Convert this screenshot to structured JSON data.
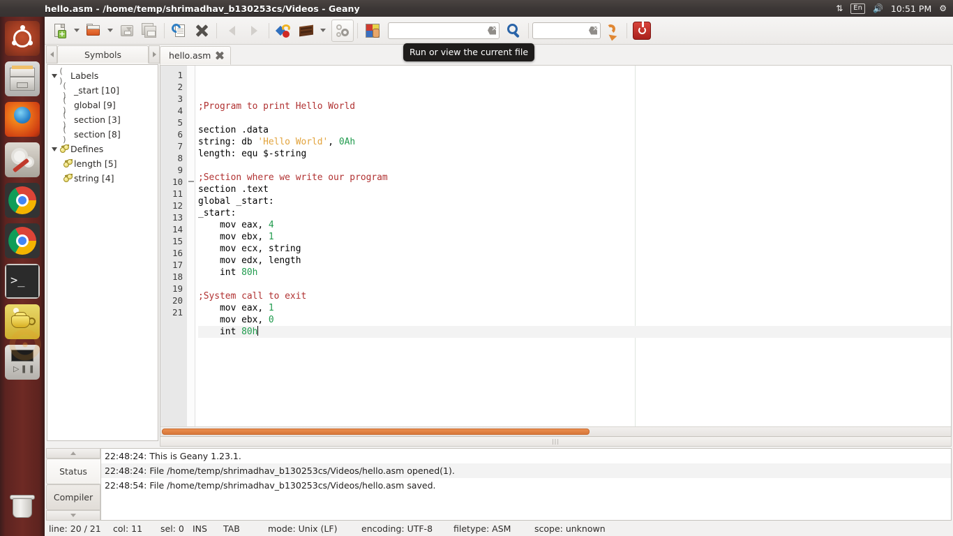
{
  "top_panel": {
    "window_title": "hello.asm - /home/temp/shrimadhav_b130253cs/Videos - Geany",
    "tray": {
      "network_icon": "network-updown-icon",
      "keyboard_layout": "En",
      "volume_icon": "volume-icon",
      "clock": "10:51 PM",
      "settings_icon": "gear-icon"
    }
  },
  "launcher": {
    "items": [
      {
        "name": "ubuntu-dash",
        "label": "Ubuntu Dash",
        "running": false
      },
      {
        "name": "files",
        "label": "Files",
        "running": true
      },
      {
        "name": "firefox",
        "label": "Firefox",
        "running": true
      },
      {
        "name": "system-settings",
        "label": "System Settings",
        "running": false
      },
      {
        "name": "chrome",
        "label": "Google Chrome",
        "running": false
      },
      {
        "name": "chrome-2",
        "label": "Google Chrome",
        "running": true
      },
      {
        "name": "terminal",
        "label": "Terminal",
        "running": true
      },
      {
        "name": "java-app",
        "label": "Java Application",
        "running": true,
        "focused": true
      },
      {
        "name": "media-player",
        "label": "Media Player",
        "running": false
      },
      {
        "name": "trash",
        "label": "Trash",
        "running": false
      }
    ]
  },
  "toolbar": {
    "new_label": "New",
    "open_label": "Open",
    "save_label": "Save",
    "save_all_label": "Save All",
    "revert_label": "Revert",
    "close_label": "Close",
    "back_label": "Navigate back a location",
    "forward_label": "Navigate forward a location",
    "compile_label": "Compile the current file",
    "build_label": "Build the current file",
    "build_menu_label": "Build menu",
    "run_label": "Run or view the current file",
    "color_chooser_label": "Open Color Chooser",
    "search_value": "",
    "search_placeholder": "",
    "goto_value": "",
    "goto_placeholder": "",
    "find_label": "Find the entered text in the current file",
    "jump_label": "Jump to the entered line number",
    "quit_label": "Quit Geany"
  },
  "tooltip": {
    "text": "Run or view the current file"
  },
  "sidebar": {
    "tab_label": "Symbols",
    "prev_arrow": "chevron-left-icon",
    "next_arrow": "chevron-right-icon",
    "tree": [
      {
        "label": "Labels",
        "type": "group",
        "icon": "braces-icon",
        "expanded": true
      },
      {
        "label": "_start [10]",
        "type": "symbol",
        "icon": "braces-icon"
      },
      {
        "label": "global [9]",
        "type": "symbol",
        "icon": "braces-icon"
      },
      {
        "label": "section [3]",
        "type": "symbol",
        "icon": "braces-icon"
      },
      {
        "label": "section [8]",
        "type": "symbol",
        "icon": "braces-icon"
      },
      {
        "label": "Defines",
        "type": "group",
        "icon": "define-icon",
        "expanded": true
      },
      {
        "label": "length [5]",
        "type": "symbol",
        "icon": "define-icon"
      },
      {
        "label": "string [4]",
        "type": "symbol",
        "icon": "define-icon"
      }
    ]
  },
  "editor": {
    "tab_label": "hello.asm",
    "close_icon": "close-icon",
    "line_numbers": [
      "1",
      "2",
      "3",
      "4",
      "5",
      "6",
      "7",
      "8",
      "9",
      "10",
      "11",
      "12",
      "13",
      "14",
      "15",
      "16",
      "17",
      "18",
      "19",
      "20",
      "21"
    ],
    "current_line": 20,
    "lines": [
      {
        "n": 1,
        "tokens": [
          {
            "t": ";Program to print Hello World",
            "c": "comment"
          }
        ]
      },
      {
        "n": 2,
        "tokens": []
      },
      {
        "n": 3,
        "tokens": [
          {
            "t": "section .data",
            "c": "plain"
          }
        ]
      },
      {
        "n": 4,
        "tokens": [
          {
            "t": "string: db ",
            "c": "plain"
          },
          {
            "t": "'Hello World'",
            "c": "string"
          },
          {
            "t": ", ",
            "c": "plain"
          },
          {
            "t": "0Ah",
            "c": "number"
          }
        ]
      },
      {
        "n": 5,
        "tokens": [
          {
            "t": "length: equ $-string",
            "c": "plain"
          }
        ]
      },
      {
        "n": 6,
        "tokens": []
      },
      {
        "n": 7,
        "tokens": [
          {
            "t": ";Section where we write our program",
            "c": "comment"
          }
        ]
      },
      {
        "n": 8,
        "tokens": [
          {
            "t": "section .text",
            "c": "plain"
          }
        ]
      },
      {
        "n": 9,
        "tokens": [
          {
            "t": "global _start:",
            "c": "plain"
          }
        ]
      },
      {
        "n": 10,
        "tokens": [
          {
            "t": "_start:",
            "c": "plain"
          }
        ]
      },
      {
        "n": 11,
        "tokens": [
          {
            "t": "    mov eax, ",
            "c": "plain"
          },
          {
            "t": "4",
            "c": "number"
          }
        ]
      },
      {
        "n": 12,
        "tokens": [
          {
            "t": "    mov ebx, ",
            "c": "plain"
          },
          {
            "t": "1",
            "c": "number"
          }
        ]
      },
      {
        "n": 13,
        "tokens": [
          {
            "t": "    mov ecx, string",
            "c": "plain"
          }
        ]
      },
      {
        "n": 14,
        "tokens": [
          {
            "t": "    mov edx, length",
            "c": "plain"
          }
        ]
      },
      {
        "n": 15,
        "tokens": [
          {
            "t": "    int ",
            "c": "plain"
          },
          {
            "t": "80h",
            "c": "number"
          }
        ]
      },
      {
        "n": 16,
        "tokens": []
      },
      {
        "n": 17,
        "tokens": [
          {
            "t": ";System call to exit",
            "c": "comment"
          }
        ]
      },
      {
        "n": 18,
        "tokens": [
          {
            "t": "    mov eax, ",
            "c": "plain"
          },
          {
            "t": "1",
            "c": "number"
          }
        ]
      },
      {
        "n": 19,
        "tokens": [
          {
            "t": "    mov ebx, ",
            "c": "plain"
          },
          {
            "t": "0",
            "c": "number"
          }
        ]
      },
      {
        "n": 20,
        "tokens": [
          {
            "t": "    int ",
            "c": "plain"
          },
          {
            "t": "80h",
            "c": "number"
          }
        ]
      },
      {
        "n": 21,
        "tokens": []
      }
    ],
    "colors": {
      "comment": "#b03030",
      "string": "#e2a33c",
      "number": "#1f9a4c",
      "plain": "#000000",
      "gutter_bg": "#e8e8e8",
      "current_line_bg": "#f3f3f3",
      "scrollbar": "#e08f50"
    }
  },
  "message_window": {
    "scroll_up_icon": "chevron-up-icon",
    "scroll_down_icon": "chevron-down-icon",
    "tabs": [
      {
        "label": "Status",
        "active": true
      },
      {
        "label": "Compiler",
        "active": false
      }
    ],
    "messages": [
      "22:48:24: This is Geany 1.23.1.",
      "22:48:24: File /home/temp/shrimadhav_b130253cs/Videos/hello.asm opened(1).",
      "22:48:54: File /home/temp/shrimadhav_b130253cs/Videos/hello.asm saved."
    ]
  },
  "statusbar": {
    "segments": [
      "line: 20 / 21",
      "col: 11",
      "sel: 0",
      "INS",
      "TAB",
      "mode: Unix (LF)",
      "encoding: UTF-8",
      "filetype: ASM",
      "scope: unknown"
    ]
  }
}
